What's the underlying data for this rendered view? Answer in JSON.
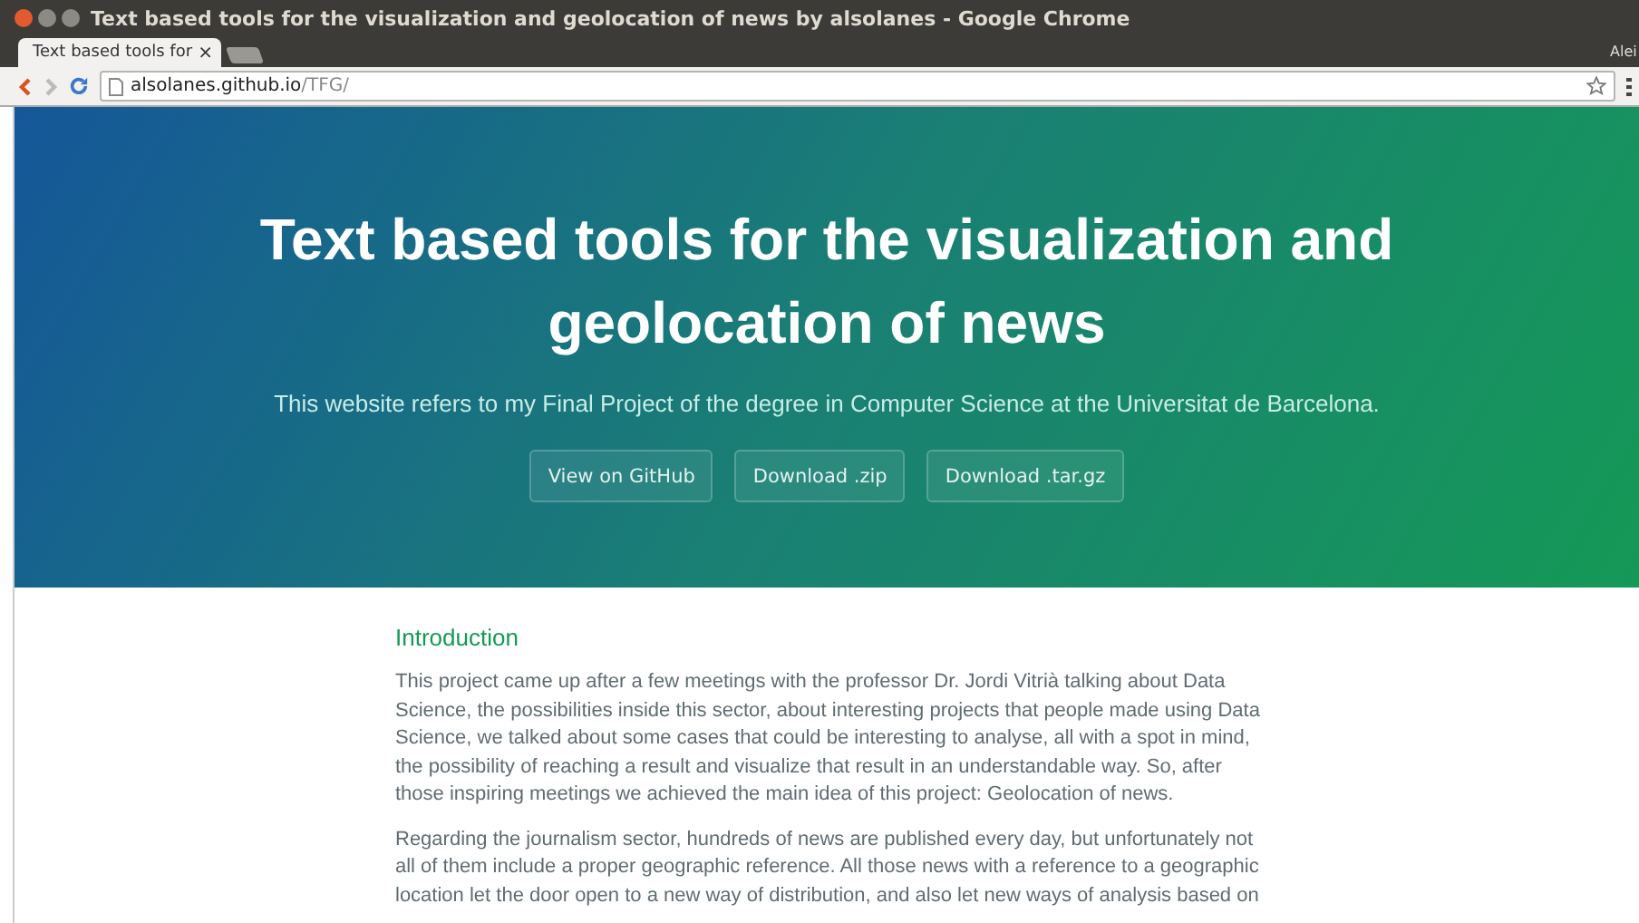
{
  "window": {
    "title": "Text based tools for the visualization and geolocation of news by alsolanes - Google Chrome",
    "profile": "Alei"
  },
  "tabs": [
    {
      "label": "Text based tools for",
      "close": "×",
      "selected": true
    }
  ],
  "address_bar": {
    "host": "alsolanes.github.io",
    "path": "/TFG/"
  },
  "header": {
    "title": "Text based tools for the visualization and geolocation of news",
    "subtitle": "This website refers to my Final Project of the degree in Computer Science at the Universitat de Barcelona.",
    "buttons": [
      "View on GitHub",
      "Download .zip",
      "Download .tar.gz"
    ]
  },
  "content": {
    "heading": "Introduction",
    "paragraphs": [
      "This project came up after a few meetings with the professor Dr. Jordi Vitrià talking about Data Science, the possibilities inside this sector, about interesting projects that people made using Data Science, we talked about some cases that could be interesting to analyse, all with a spot in mind, the possibility of reaching a result and visualize that result in an understandable way. So, after those inspiring meetings we achieved the main idea of this project: Geolocation of news.",
      "Regarding the journalism sector, hundreds of news are published every day, but unfortunately not all of them include a proper geographic reference. All those news with a reference to a geographic location let the door open to a new way of distribution, and also let new ways of analysis based on"
    ]
  }
}
